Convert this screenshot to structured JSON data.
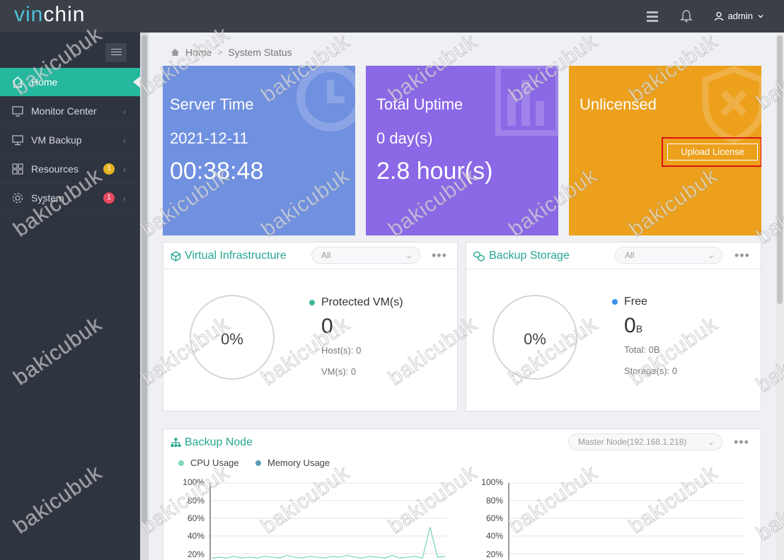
{
  "app": {
    "logo_prefix": "vin",
    "logo_suffix": "chin"
  },
  "topbar": {
    "user": "admin"
  },
  "sidebar": {
    "items": [
      {
        "label": "Home",
        "icon": "home-icon",
        "active": true
      },
      {
        "label": "Monitor Center",
        "icon": "monitor-icon"
      },
      {
        "label": "VM Backup",
        "icon": "desktop-icon"
      },
      {
        "label": "Resources",
        "icon": "grid-icon",
        "badge": "1",
        "badge_color": "#e6b422"
      },
      {
        "label": "System",
        "icon": "gear-icon",
        "badge": "1",
        "badge_color": "#e84a5f"
      }
    ]
  },
  "breadcrumb": {
    "home": "Home",
    "separator": ">",
    "current": "System Status"
  },
  "cards": {
    "server_time": {
      "title": "Server Time",
      "date": "2021-12-11",
      "time": "00:38:48",
      "color": "#7090e0"
    },
    "uptime": {
      "title": "Total Uptime",
      "days": "0 day(s)",
      "hours": "2.8 hour(s)",
      "color": "#8a68e6"
    },
    "license": {
      "title": "Unlicensed",
      "button": "Upload License",
      "color": "#eca01c"
    }
  },
  "virtual_infra": {
    "title": "Virtual Infrastructure",
    "filter": "All",
    "percent": "0%",
    "legend": "Protected VM(s)",
    "legend_color": "#3fb59a",
    "count": "0",
    "hosts": "Host(s): 0",
    "vms": "VM(s): 0"
  },
  "backup_storage": {
    "title": "Backup Storage",
    "filter": "All",
    "percent": "0%",
    "legend": "Free",
    "legend_color": "#3a8fe8",
    "free_value": "0",
    "free_unit": "B",
    "total": "Total: 0B",
    "storages": "Storage(s): 0"
  },
  "backup_node": {
    "title": "Backup Node",
    "node": "Master Node(192.168.1.218)",
    "legend_cpu": "CPU Usage",
    "legend_mem": "Memory Usage",
    "cpu_color": "#7fd8c0",
    "mem_color": "#5b9fb5",
    "ticks": [
      "100%",
      "80%",
      "60%",
      "40%",
      "20%"
    ]
  },
  "chart_data": {
    "type": "line",
    "series": [
      {
        "name": "CPU Usage",
        "values": [
          3,
          4,
          3,
          5,
          3,
          4,
          3,
          5,
          4,
          3,
          6,
          4,
          3,
          5,
          4,
          3,
          5,
          4,
          6,
          4,
          3,
          5,
          4,
          3,
          6,
          3,
          4,
          5,
          3,
          38,
          4,
          5
        ]
      }
    ],
    "ylim": [
      0,
      100
    ],
    "yticks": [
      "100%",
      "80%",
      "60%",
      "40%",
      "20%"
    ]
  },
  "watermark": "bakicubuk"
}
